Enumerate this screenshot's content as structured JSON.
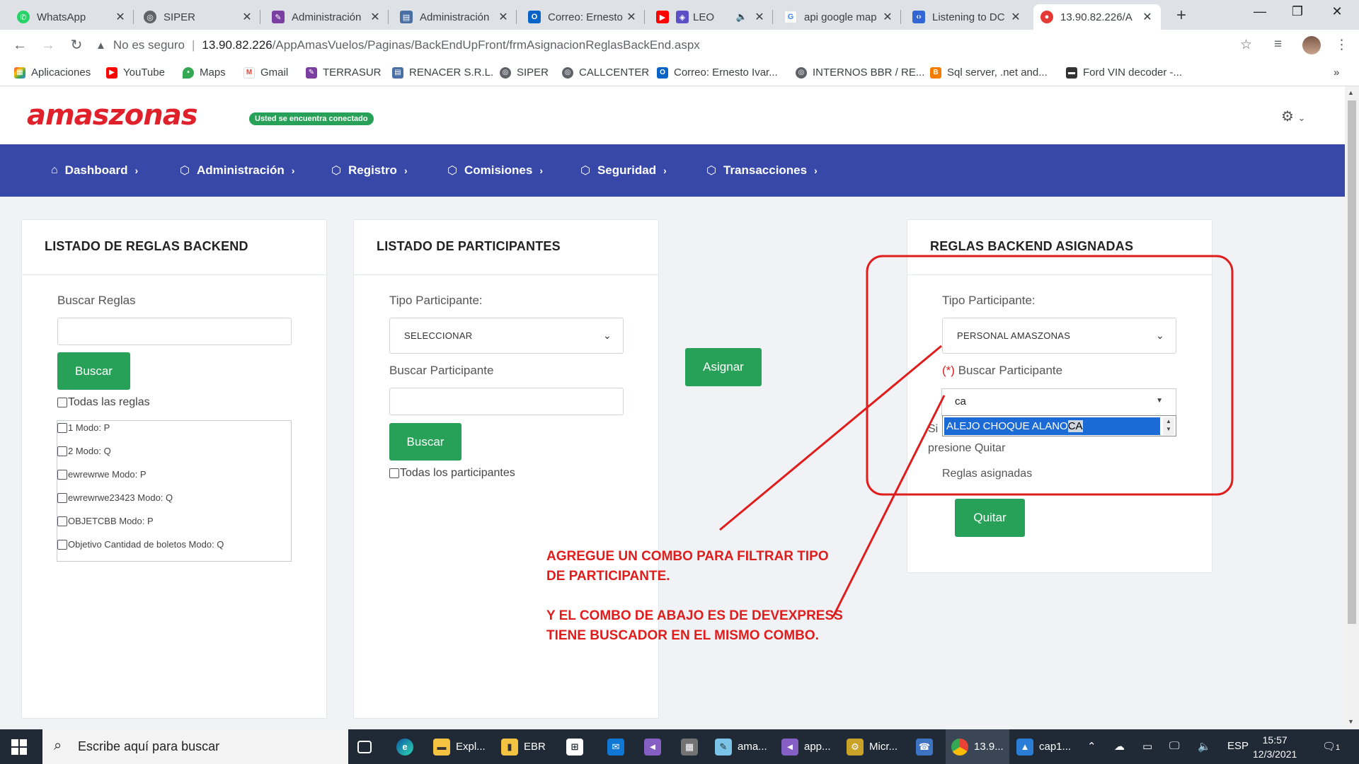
{
  "browser": {
    "tabs": [
      {
        "title": "WhatsApp",
        "icon": "whatsapp-icon",
        "color": "#25d366"
      },
      {
        "title": "SIPER",
        "icon": "globe-icon",
        "color": "#5f6368"
      },
      {
        "title": "Administración",
        "icon": "admin-icon",
        "color": "#7a3fa0"
      },
      {
        "title": "Administración",
        "icon": "chart-icon",
        "color": "#4a6fa5"
      },
      {
        "title": "Correo: Ernesto",
        "icon": "outlook-icon",
        "color": "#0a64c8"
      },
      {
        "title": "LEO",
        "icon": "youtube-icon",
        "color": "#ff0000"
      },
      {
        "title": "api google map",
        "icon": "google-icon",
        "color": "#4285f4"
      },
      {
        "title": "Listening to DC",
        "icon": "code-icon",
        "color": "#3367d6"
      },
      {
        "title": "13.90.82.226/A",
        "icon": "site-icon",
        "color": "#e53935"
      }
    ],
    "address": {
      "insecure_label": "No es seguro",
      "host": "13.90.82.226",
      "path": "/AppAmasVuelos/Paginas/BackEndUpFront/frmAsignacionReglasBackEnd.aspx"
    },
    "bookmarks": [
      {
        "label": "Aplicaciones",
        "icon": "apps-grid-icon",
        "color": "#ea4335"
      },
      {
        "label": "YouTube",
        "icon": "youtube-icon",
        "color": "#ff0000"
      },
      {
        "label": "Maps",
        "icon": "maps-pin-icon",
        "color": "#34a853"
      },
      {
        "label": "Gmail",
        "icon": "gmail-icon",
        "color": "#ea4335"
      },
      {
        "label": "TERRASUR",
        "icon": "bookmark-icon",
        "color": "#7a3fa0"
      },
      {
        "label": "RENACER S.R.L.",
        "icon": "bookmark-icon",
        "color": "#4a6fa5"
      },
      {
        "label": "SIPER",
        "icon": "globe-icon",
        "color": "#5f6368"
      },
      {
        "label": "CALLCENTER",
        "icon": "globe-icon",
        "color": "#5f6368"
      },
      {
        "label": "Correo: Ernesto Ivar...",
        "icon": "outlook-icon",
        "color": "#0a64c8"
      },
      {
        "label": "INTERNOS BBR / RE...",
        "icon": "globe-icon",
        "color": "#5f6368"
      },
      {
        "label": "Sql server, .net and...",
        "icon": "blogger-icon",
        "color": "#f57c00"
      },
      {
        "label": "Ford VIN decoder -...",
        "icon": "car-icon",
        "color": "#333333"
      }
    ]
  },
  "site": {
    "logo": "amaszonas",
    "status_badge": "Usted se encuentra conectado",
    "nav": [
      {
        "label": "Dashboard",
        "icon": "home-icon"
      },
      {
        "label": "Administración",
        "icon": "cube-icon"
      },
      {
        "label": "Registro",
        "icon": "cube-icon"
      },
      {
        "label": "Comisiones",
        "icon": "cube-icon"
      },
      {
        "label": "Seguridad",
        "icon": "cube-icon"
      },
      {
        "label": "Transacciones",
        "icon": "cube-icon"
      }
    ]
  },
  "reglas_card": {
    "title": "LISTADO DE REGLAS BACKEND",
    "search_label": "Buscar Reglas",
    "search_value": "",
    "search_button": "Buscar",
    "all_checkbox": "Todas las reglas",
    "rules": [
      "1 Modo: P",
      "2 Modo: Q",
      "ewrewrwe Modo: P",
      "ewrewrwe23423 Modo: Q",
      "OBJETCBB Modo: P",
      "Objetivo Cantidad de boletos Modo: Q"
    ]
  },
  "participantes_card": {
    "title": "LISTADO DE PARTICIPANTES",
    "type_label": "Tipo Participante:",
    "type_value": "SELECCIONAR",
    "search_label": "Buscar Participante",
    "search_value": "",
    "search_button": "Buscar",
    "all_checkbox": "Todas los participantes"
  },
  "assign_button": "Asignar",
  "asignadas_card": {
    "title": "REGLAS BACKEND ASIGNADAS",
    "type_label": "Tipo Participante:",
    "type_value": "PERSONAL AMASZONAS",
    "required_mark": "(*)",
    "search_label": "Buscar Participante",
    "combo_value": "ca",
    "dropdown_item_prefix": "ALEJO CHOQUE ALANO",
    "dropdown_item_match": "CA",
    "hint_fragment_1": "Si",
    "hint_fragment_2": "presione Quitar",
    "assigned_label": "Reglas asignadas",
    "remove_button": "Quitar"
  },
  "annotation": {
    "text": "AGREGUE UN COMBO PARA FILTRAR TIPO\nDE PARTICIPANTE.\n\nY EL COMBO DE ABAJO ES DE DEVEXPRESS\nTIENE BUSCADOR EN EL MISMO COMBO.",
    "color": "#e01d1d"
  },
  "taskbar": {
    "search_placeholder": "Escribe aquí para buscar",
    "apps": [
      {
        "label": "",
        "icon": "task-view-icon"
      },
      {
        "label": "",
        "icon": "edge-icon"
      },
      {
        "label": "Expl...",
        "icon": "folder-icon"
      },
      {
        "label": "EBR",
        "icon": "folder-icon"
      },
      {
        "label": "",
        "icon": "store-icon"
      },
      {
        "label": "",
        "icon": "mail-icon"
      },
      {
        "label": "",
        "icon": "visual-studio-icon"
      },
      {
        "label": "",
        "icon": "calculator-icon"
      },
      {
        "label": "ama...",
        "icon": "notepad-icon"
      },
      {
        "label": "app...",
        "icon": "visual-studio-icon"
      },
      {
        "label": "Micr...",
        "icon": "sql-server-icon"
      },
      {
        "label": "",
        "icon": "network-user-icon"
      },
      {
        "label": "13.9...",
        "icon": "chrome-icon"
      },
      {
        "label": "cap1...",
        "icon": "photos-icon"
      }
    ],
    "language": "ESP",
    "time": "15:57",
    "date": "12/3/2021",
    "notification_count": "1"
  }
}
